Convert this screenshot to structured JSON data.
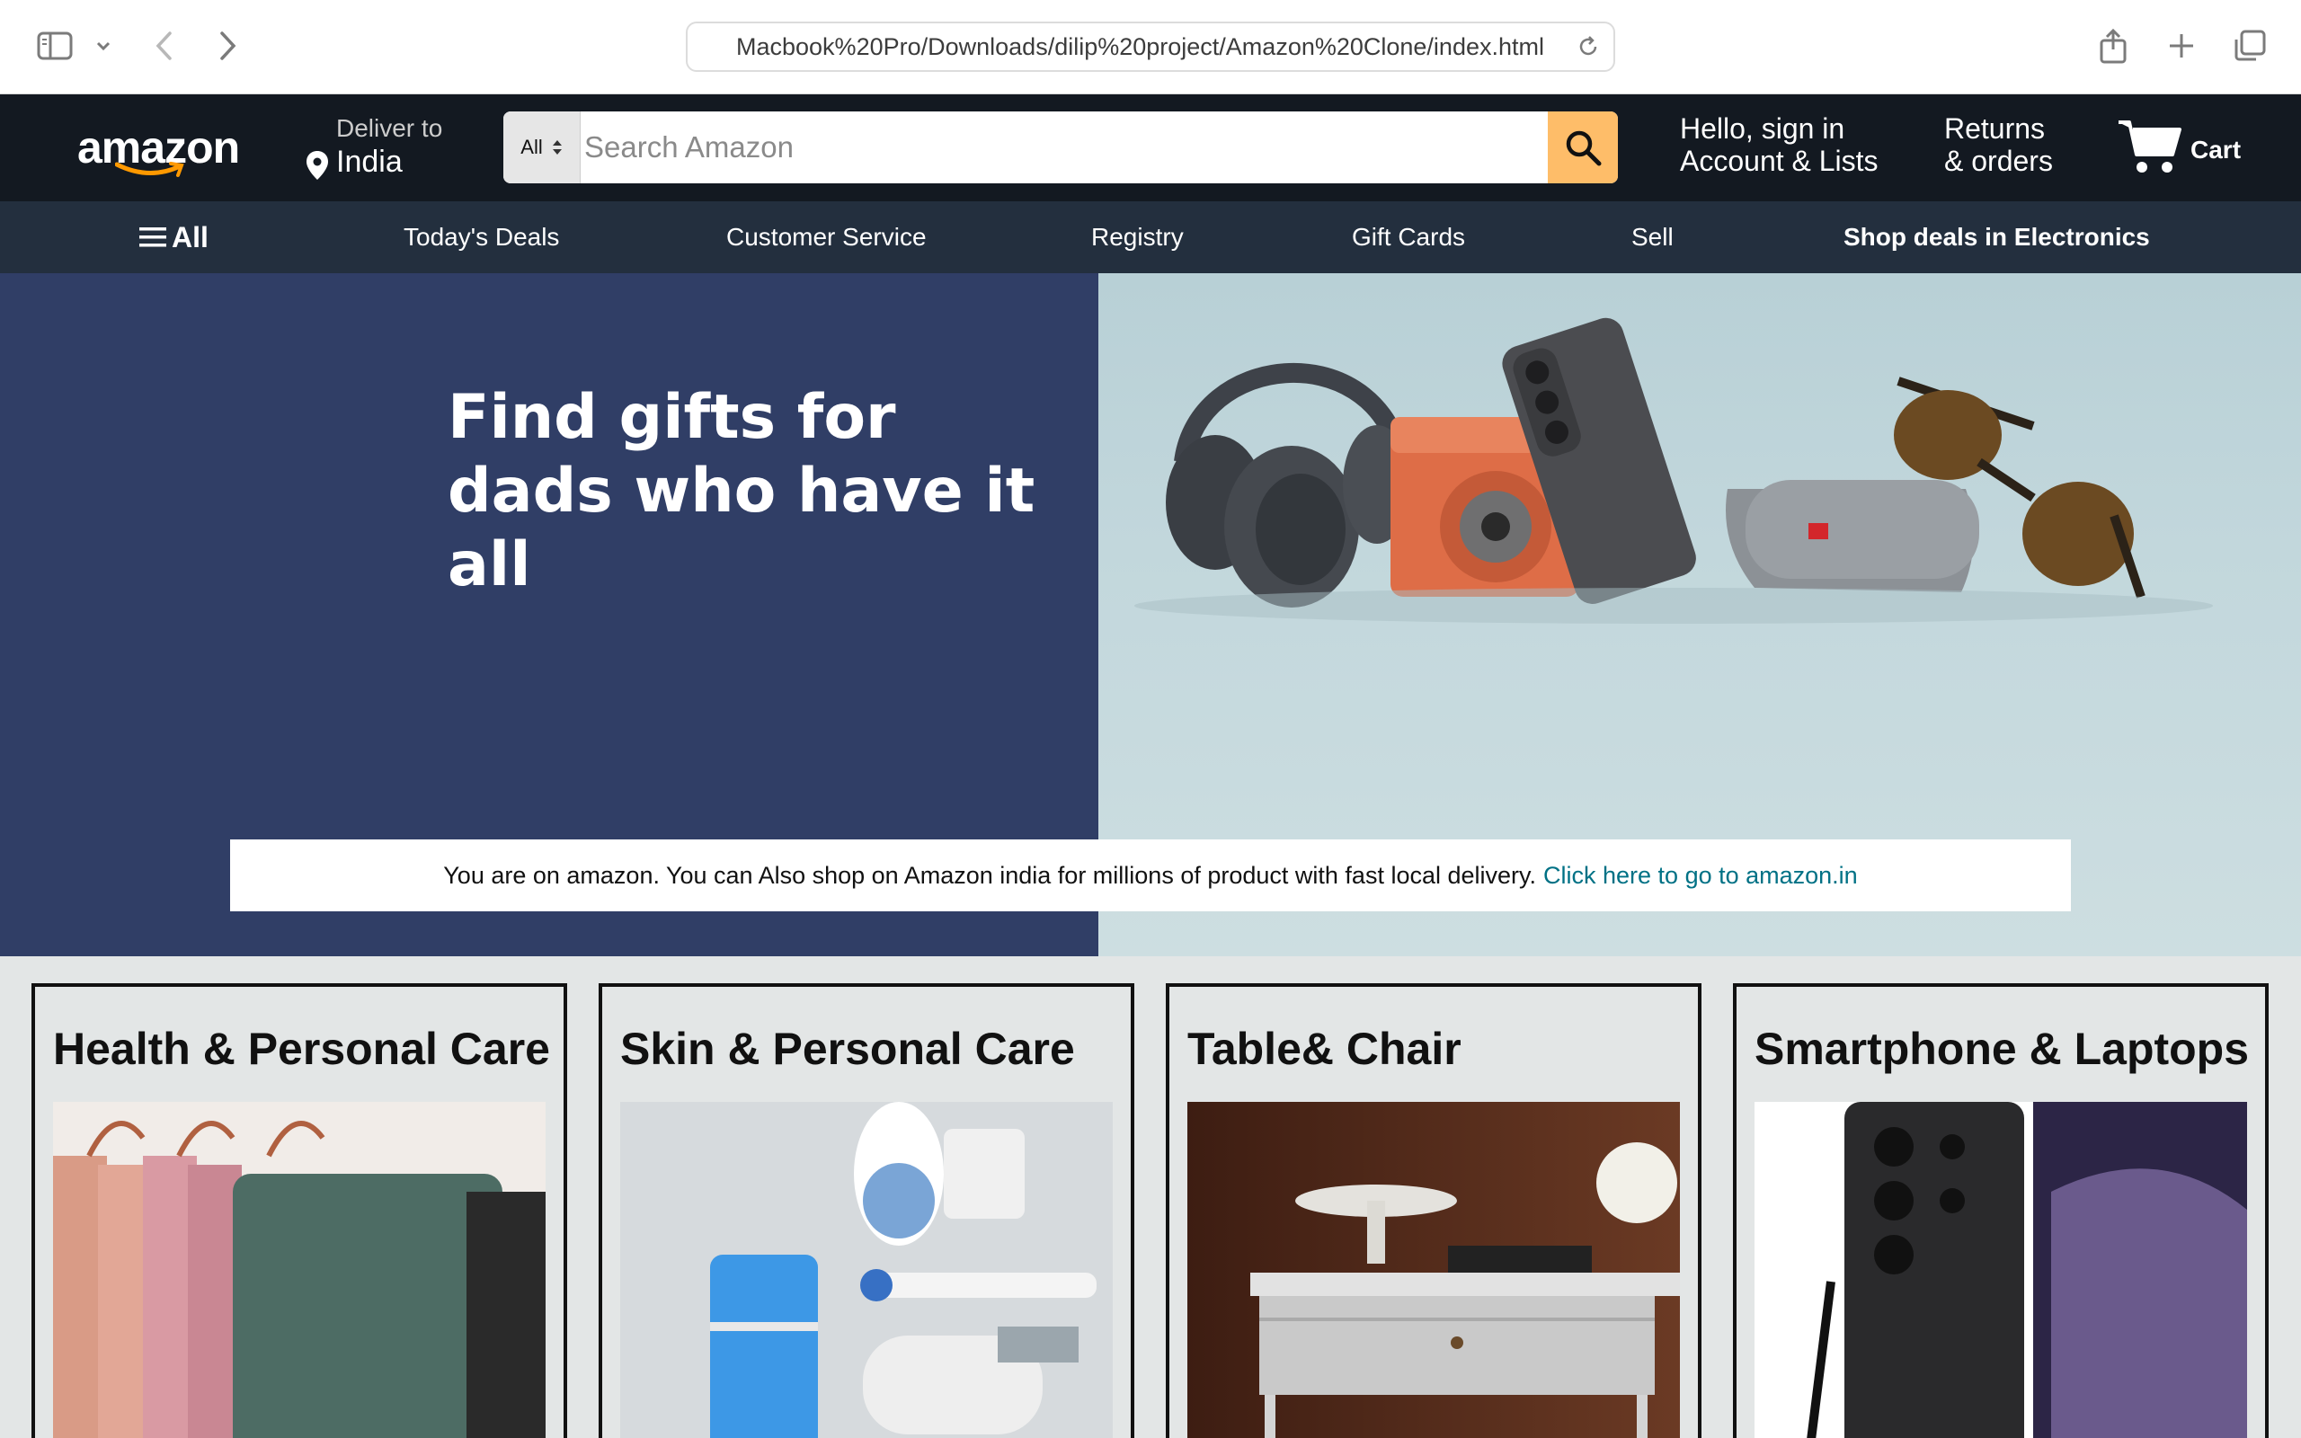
{
  "browser": {
    "url": "Macbook%20Pro/Downloads/dilip%20project/Amazon%20Clone/index.html",
    "icons": [
      "sidebar-icon",
      "chevron-down-icon",
      "back-arrow-icon",
      "forward-arrow-icon",
      "reload-icon",
      "share-icon",
      "plus-icon",
      "tabs-icon"
    ]
  },
  "header": {
    "logo_text": "amazon",
    "deliver": {
      "label": "Deliver to",
      "location": "India"
    },
    "search": {
      "category": "All",
      "placeholder": "Search Amazon"
    },
    "account": {
      "line1": "Hello, sign in",
      "line2": "Account & Lists"
    },
    "orders": {
      "line1": "Returns",
      "line2": "& orders"
    },
    "cart_label": "Cart",
    "accent_color": "#febd69",
    "bg_color": "#131921"
  },
  "subnav": {
    "all_label": "All",
    "items": [
      "Today's Deals",
      "Customer Service",
      "Registry",
      "Gift Cards",
      "Sell"
    ],
    "highlight": "Shop deals in Electronics",
    "bg_color": "#232f3e"
  },
  "hero": {
    "title_line1": "Find gifts for",
    "title_line2": "dads who have it all",
    "left_color": "#303e66"
  },
  "notice": {
    "text": "You are on amazon. You can Also shop on Amazon india for millions of product with fast local delivery.",
    "link": "Click here to go to amazon.in",
    "link_color": "#007185"
  },
  "cards": [
    {
      "title": "Health & Personal Care"
    },
    {
      "title": "Skin & Personal Care"
    },
    {
      "title": "Table& Chair"
    },
    {
      "title": "Smartphone & Laptops"
    }
  ]
}
